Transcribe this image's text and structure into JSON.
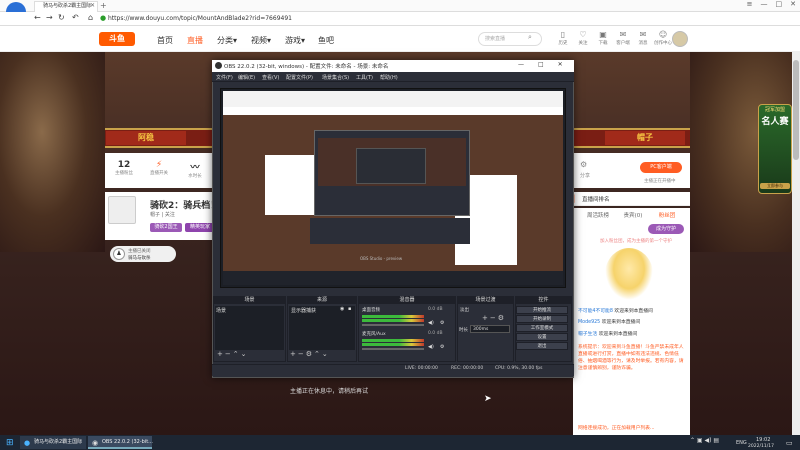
{
  "browser": {
    "tab_title": "骑马与砍杀2霸主国际",
    "url": "https://www.douyu.com/topic/MountAndBlade2?rid=7669491",
    "win_controls": [
      "≡",
      "—",
      "□",
      "✕"
    ]
  },
  "site": {
    "logo": "斗鱼",
    "nav": [
      "首页",
      "直播",
      "分类",
      "视频",
      "游戏",
      "鱼吧"
    ],
    "search_placeholder": "搜索直播",
    "user_buttons": [
      {
        "icon": "▯",
        "label": "历史"
      },
      {
        "icon": "♡",
        "label": "关注"
      },
      {
        "icon": "▣",
        "label": "下载"
      },
      {
        "icon": "✉",
        "label": "客户端"
      },
      {
        "icon": "✉",
        "label": "消息"
      },
      {
        "icon": "☺",
        "label": "创作中心"
      }
    ]
  },
  "event": {
    "team_left": "阿稳",
    "team_right": "帽子",
    "badge_title": "冠军加盟",
    "badge_rank": "名人赛",
    "badge_btn": "立即参与"
  },
  "room": {
    "stats": [
      {
        "n": "12",
        "l": "主播粉丝"
      },
      {
        "n": "⚡",
        "l": "直播开关"
      },
      {
        "n": "〰",
        "l": "水时长"
      }
    ],
    "streamer_name": "骑砍2：骑兵档！",
    "streamer_sub": "帽子 | 关注",
    "tag1": "骑砍2国王",
    "tag2": "精英玩家",
    "follow_line1": "主播已关闭",
    "follow_line2": "骑马与砍杀",
    "offline_text": "主播正在休息中，请稍后再试"
  },
  "right": {
    "tab_a": "⚙",
    "tab_b": "分享",
    "pc_btn": "PC客户端",
    "pc_sub": "主播正在开播中",
    "rank_label": "直播间排名",
    "chat_tabs": [
      "周活跃榜",
      "贵宾(0)",
      "粉丝团"
    ],
    "guard_btn": "成为守护",
    "chat_hint": "加入粉丝团，成为主播的第一个守护",
    "messages": [
      {
        "user": "不可能4不可能8",
        "text": "欢迎来到本直播间"
      },
      {
        "user": "Mode925",
        "text": "欢迎来到本直播间"
      },
      {
        "user": "帽子生活",
        "text": "欢迎来到本直播间"
      }
    ],
    "notice": "系统提示：欢迎来到斗鱼直播！斗鱼严禁未成年人直播或进行打赏，直播中如有违法违规、色情低俗、抽烟喝酒等行为，请及时举报。若有内容，请注意谨慎辨别，谨防诈骗。",
    "bottom": "网络连接成功，正在加载用户列表..."
  },
  "obs": {
    "title": "OBS 22.0.2 (32-bit, windows) - 配置文件: 未命名 - 场景: 未命名",
    "menus": [
      "文件(F)",
      "编辑(E)",
      "查看(V)",
      "配置文件(P)",
      "场景集合(S)",
      "工具(T)",
      "帮助(H)"
    ],
    "preview_caption": "OBS Studio - preview",
    "docks": {
      "scenes": "场景",
      "sources": "来源",
      "mixer": "混音器",
      "transitions": "场景过渡",
      "controls": "控件"
    },
    "scene_item": "场景",
    "source_item": "显示器捕获",
    "mixer": [
      {
        "label": "桌面音频",
        "db": "0.0 dB"
      },
      {
        "label": "麦克风/Aux",
        "db": "0.0 dB"
      }
    ],
    "transition": "淡出",
    "duration_label": "时长",
    "duration": "300ms",
    "controls": [
      "开始推流",
      "开始录制",
      "工作室模式",
      "设置",
      "退出"
    ],
    "status": [
      "LIVE: 00:00:00",
      "REC: 00:00:00",
      "CPU: 0.9%, 30.00 fps"
    ]
  },
  "taskbar": {
    "task1": "骑马与砍杀2霸主国际",
    "task2": "OBS 22.0.2 (32-bit...",
    "lang": "ENG",
    "time": "19:02",
    "date": "2022/11/17"
  }
}
